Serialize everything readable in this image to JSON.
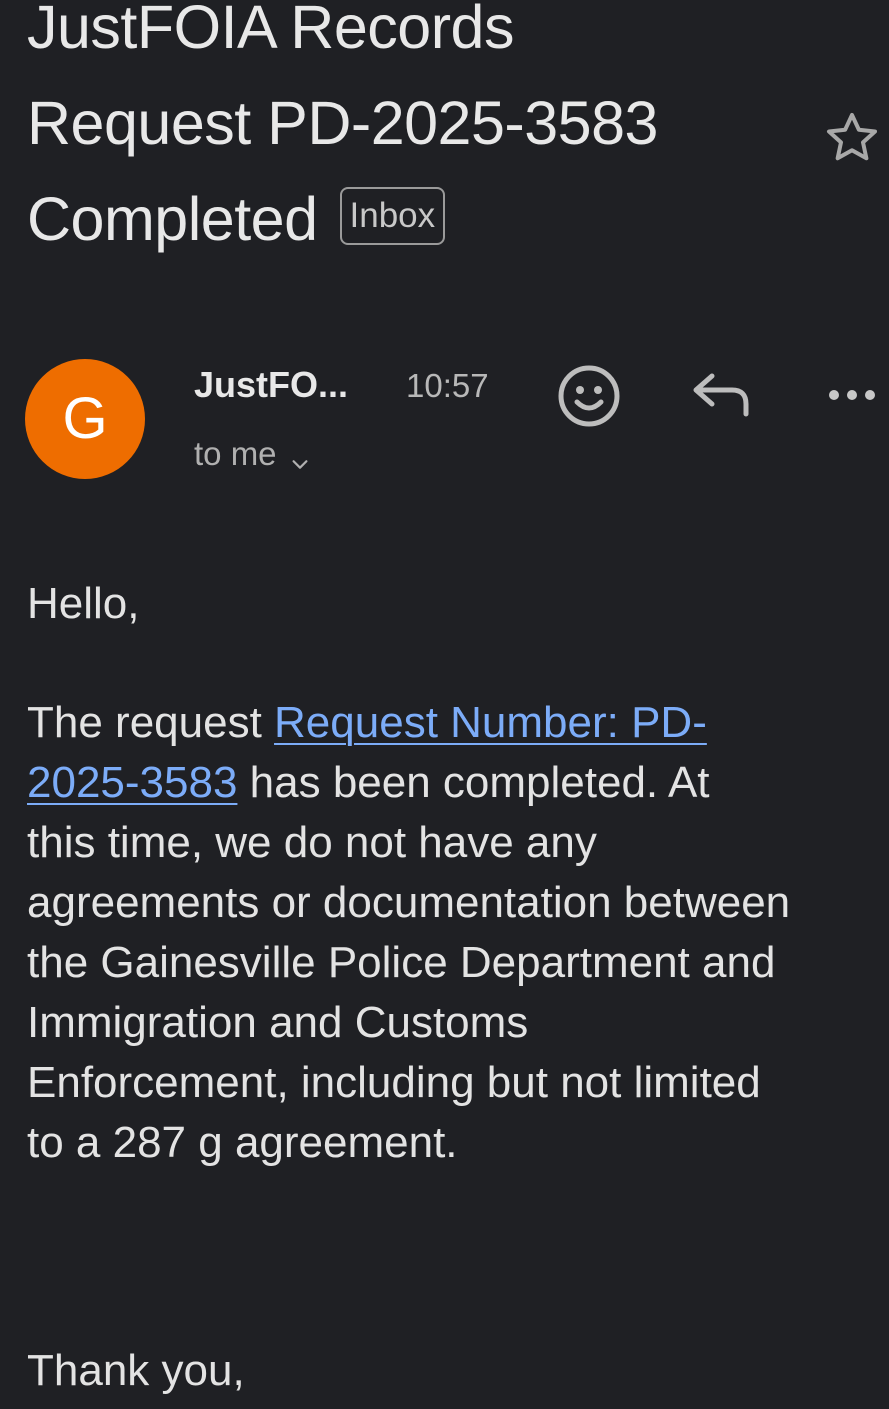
{
  "email": {
    "subject_line_1": "JustFOIA Records",
    "subject_line_2": "Request PD-2025-3583",
    "subject_line_3": "Completed",
    "label_chip": "Inbox",
    "star_icon": "star-outline-icon",
    "sender": {
      "avatar_letter": "G",
      "avatar_color": "#ee6d00",
      "name": "JustFO...",
      "time": "10:57",
      "recipient": "to me"
    },
    "actions": {
      "emoji_icon": "smiley-icon",
      "reply_icon": "reply-icon",
      "more_icon": "more-horizontal-icon"
    },
    "body": {
      "greeting": "Hello,",
      "line_1_prefix": "The request ",
      "link_part_1": "Request Number: PD-",
      "link_part_2": "2025-3583",
      "line_2_suffix": " has been completed. At",
      "line_3": "this time, we do not have any",
      "line_4": "agreements or documentation between",
      "line_5": "the Gainesville Police Department and",
      "line_6": "Immigration and Customs",
      "line_7": "Enforcement, including but not limited",
      "line_8": "to a 287 g agreement.",
      "closing": "Thank you,"
    }
  },
  "colors": {
    "background": "#1f2024",
    "link": "#7cacf8",
    "text": "#e3e3e3"
  }
}
